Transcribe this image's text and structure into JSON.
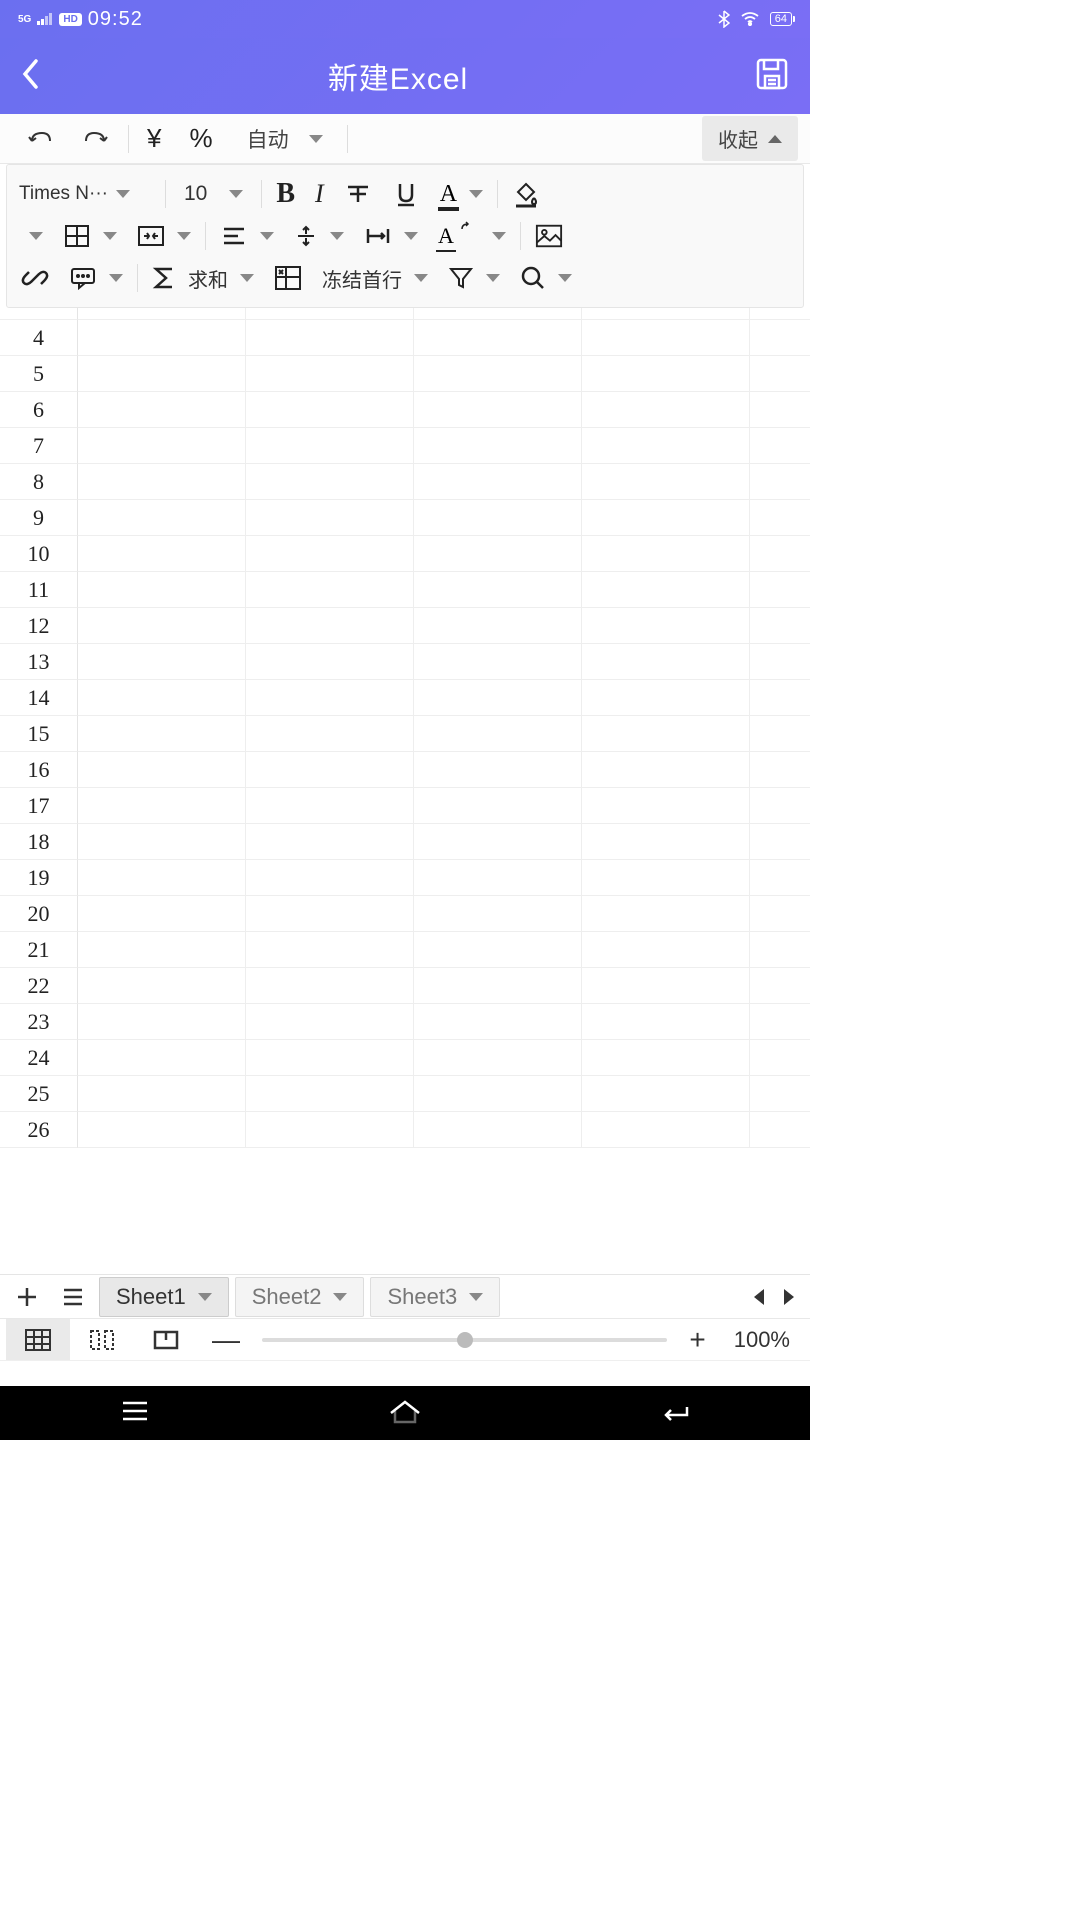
{
  "status": {
    "signal": "5G",
    "hd": "HD",
    "time": "09:52",
    "battery": "64"
  },
  "header": {
    "title": "新建Excel"
  },
  "toolbar": {
    "auto": "自动",
    "collapse": "收起"
  },
  "format": {
    "font": "Times N···",
    "size": "10",
    "sum": "求和",
    "freeze": "冻结首行"
  },
  "rows": [
    4,
    5,
    6,
    7,
    8,
    9,
    10,
    11,
    12,
    13,
    14,
    15,
    16,
    17,
    18,
    19,
    20,
    21,
    22,
    23,
    24,
    25,
    26
  ],
  "sheets": {
    "s1": "Sheet1",
    "s2": "Sheet2",
    "s3": "Sheet3"
  },
  "zoom": {
    "pct": "100%"
  }
}
